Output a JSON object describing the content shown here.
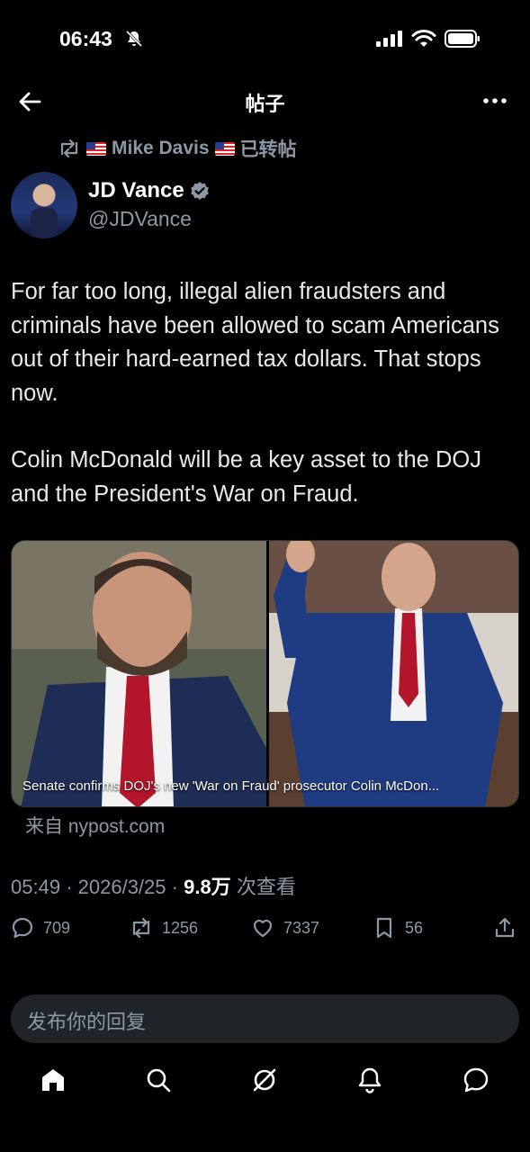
{
  "status_bar": {
    "time": "06:43"
  },
  "header": {
    "title": "帖子"
  },
  "repost": {
    "user": "Mike Davis",
    "suffix": "已转帖"
  },
  "author": {
    "name": "JD Vance",
    "handle": "@JDVance"
  },
  "tweet": {
    "paragraph1": "For far too long, illegal alien fraudsters and criminals have been allowed to scam Americans out of their hard-earned tax dollars. That stops now.",
    "paragraph2": "Colin McDonald will be a key asset to the DOJ and the President's War on Fraud."
  },
  "card": {
    "caption": "Senate confirms DOJ's new 'War on Fraud' prosecutor Colin McDon...",
    "source": "来自 nypost.com"
  },
  "meta": {
    "time": "05:49",
    "date": "2026/3/25",
    "views": "9.8万",
    "views_label": "次查看"
  },
  "actions": {
    "replies": "709",
    "reposts": "1256",
    "likes": "7337",
    "bookmarks": "56"
  },
  "reply": {
    "placeholder": "发布你的回复"
  },
  "colors": {
    "background": "#000000",
    "text": "#e7e9ea",
    "secondary": "#8b98a5",
    "verified": "#8b98a5"
  }
}
